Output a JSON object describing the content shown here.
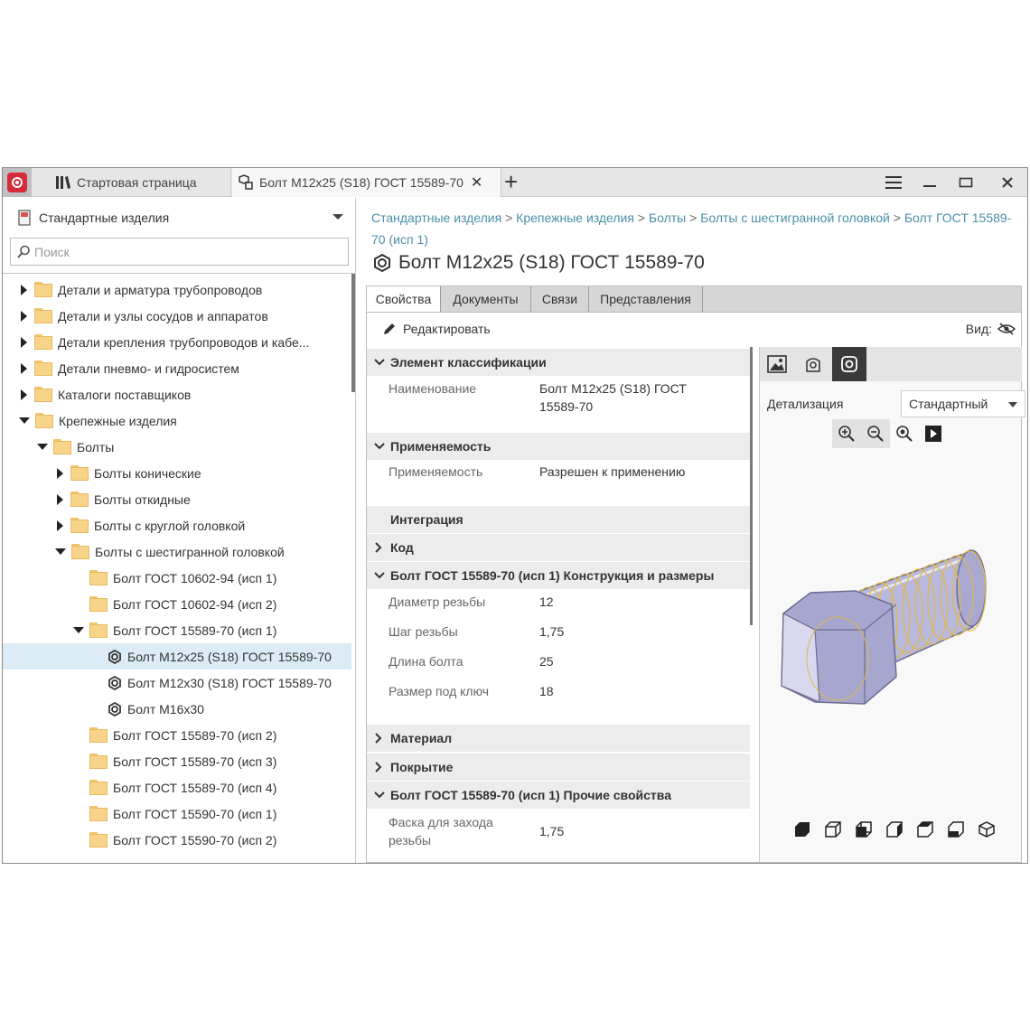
{
  "titlebar": {
    "start_tab": "Стартовая страница",
    "doc_tab": "Болт М12x25 (S18) ГОСТ 15589-70",
    "close_glyph": "✕",
    "new_tab_glyph": "+",
    "menu_glyph": "☰",
    "min_glyph": "—",
    "max_glyph": "▭",
    "close_win_glyph": "✕"
  },
  "sidebar": {
    "library": "Стандартные изделия",
    "search_placeholder": "Поиск",
    "tree": [
      {
        "label": "Детали и арматура трубопроводов",
        "state": "collapsed",
        "icon": "folder"
      },
      {
        "label": "Детали и узлы сосудов и аппаратов",
        "state": "collapsed",
        "icon": "folder"
      },
      {
        "label": "Детали крепления трубопроводов и кабе...",
        "state": "collapsed",
        "icon": "folder"
      },
      {
        "label": "Детали пневмо- и гидросистем",
        "state": "collapsed",
        "icon": "folder"
      },
      {
        "label": "Каталоги поставщиков",
        "state": "collapsed",
        "icon": "folder"
      },
      {
        "label": "Крепежные изделия",
        "state": "expanded",
        "icon": "folder"
      },
      {
        "label": "Болты",
        "state": "expanded",
        "icon": "folder"
      },
      {
        "label": "Болты конические",
        "state": "collapsed",
        "icon": "folder"
      },
      {
        "label": "Болты откидные",
        "state": "collapsed",
        "icon": "folder"
      },
      {
        "label": "Болты с круглой головкой",
        "state": "collapsed",
        "icon": "folder"
      },
      {
        "label": "Болты с шестигранной головкой",
        "state": "expanded",
        "icon": "folder"
      },
      {
        "label": "Болт ГОСТ 10602-94 (исп 1)",
        "state": "none",
        "icon": "folder"
      },
      {
        "label": "Болт ГОСТ 10602-94 (исп 2)",
        "state": "none",
        "icon": "folder"
      },
      {
        "label": "Болт ГОСТ 15589-70 (исп 1)",
        "state": "expanded",
        "icon": "folder"
      },
      {
        "label": "Болт М12x25 (S18) ГОСТ 15589-70",
        "state": "none",
        "icon": "bolt",
        "selected": true
      },
      {
        "label": "Болт М12x30 (S18) ГОСТ 15589-70",
        "state": "none",
        "icon": "bolt"
      },
      {
        "label": "Болт М16x30",
        "state": "none",
        "icon": "bolt"
      },
      {
        "label": "Болт ГОСТ 15589-70 (исп 2)",
        "state": "none",
        "icon": "folder"
      },
      {
        "label": "Болт ГОСТ 15589-70 (исп 3)",
        "state": "none",
        "icon": "folder"
      },
      {
        "label": "Болт ГОСТ 15589-70 (исп 4)",
        "state": "none",
        "icon": "folder"
      },
      {
        "label": "Болт ГОСТ 15590-70 (исп 1)",
        "state": "none",
        "icon": "folder"
      },
      {
        "label": "Болт ГОСТ 15590-70 (исп 2)",
        "state": "none",
        "icon": "folder"
      }
    ]
  },
  "breadcrumb": {
    "items": [
      "Стандартные изделия",
      "Крепежные изделия",
      "Болты",
      "Болты с шестигранной головкой",
      "Болт ГОСТ 15589-70 (исп 1)"
    ],
    "separator": ">"
  },
  "page_title": "Болт М12x25 (S18) ГОСТ 15589-70",
  "tabs": [
    "Свойства",
    "Документы",
    "Связи",
    "Представления"
  ],
  "toolbar": {
    "edit_label": "Редактировать",
    "view_label": "Вид:"
  },
  "properties": {
    "sections": [
      {
        "title": "Элемент классификации",
        "state": "expanded"
      },
      {
        "title": "Применяемость",
        "state": "expanded"
      },
      {
        "title": "Интеграция",
        "state": "none"
      },
      {
        "title": "Код",
        "state": "collapsed"
      },
      {
        "title": "Болт ГОСТ 15589-70 (исп 1) Конструкция и размеры",
        "state": "expanded"
      },
      {
        "title": "Материал",
        "state": "collapsed"
      },
      {
        "title": "Покрытие",
        "state": "collapsed"
      },
      {
        "title": "Болт ГОСТ 15589-70 (исп 1) Прочие свойства",
        "state": "expanded"
      }
    ],
    "rows": [
      {
        "key": "Наименование",
        "value": "Болт М12x25 (S18) ГОСТ 15589-70"
      },
      {
        "key": "Применяемость",
        "value": "Разрешен к применению"
      },
      {
        "key": "Диаметр резьбы",
        "value": "12"
      },
      {
        "key": "Шаг резьбы",
        "value": "1,75"
      },
      {
        "key": "Длина болта",
        "value": "25"
      },
      {
        "key": "Размер под ключ",
        "value": "18"
      },
      {
        "key": "Фаска для захода резьбы",
        "value": "1,75"
      }
    ]
  },
  "preview": {
    "detail_label": "Детализация",
    "detail_value": "Стандартный",
    "tab_icons": [
      "image-icon",
      "sketch-icon",
      "model-3d-icon"
    ],
    "zoom_icons": [
      "zoom-in-icon",
      "zoom-out-icon",
      "zoom-fit-icon",
      "play-icon"
    ],
    "view_icons": [
      "view-iso-1-icon",
      "view-iso-2-icon",
      "view-iso-3-icon",
      "view-iso-4-icon",
      "view-iso-5-icon",
      "view-iso-6-icon",
      "view-iso-7-icon"
    ]
  },
  "colors": {
    "accent_link": "#4a8fa8",
    "selection": "#dcecf6",
    "folder": "#f8d48a",
    "brand": "#d52b3c"
  }
}
